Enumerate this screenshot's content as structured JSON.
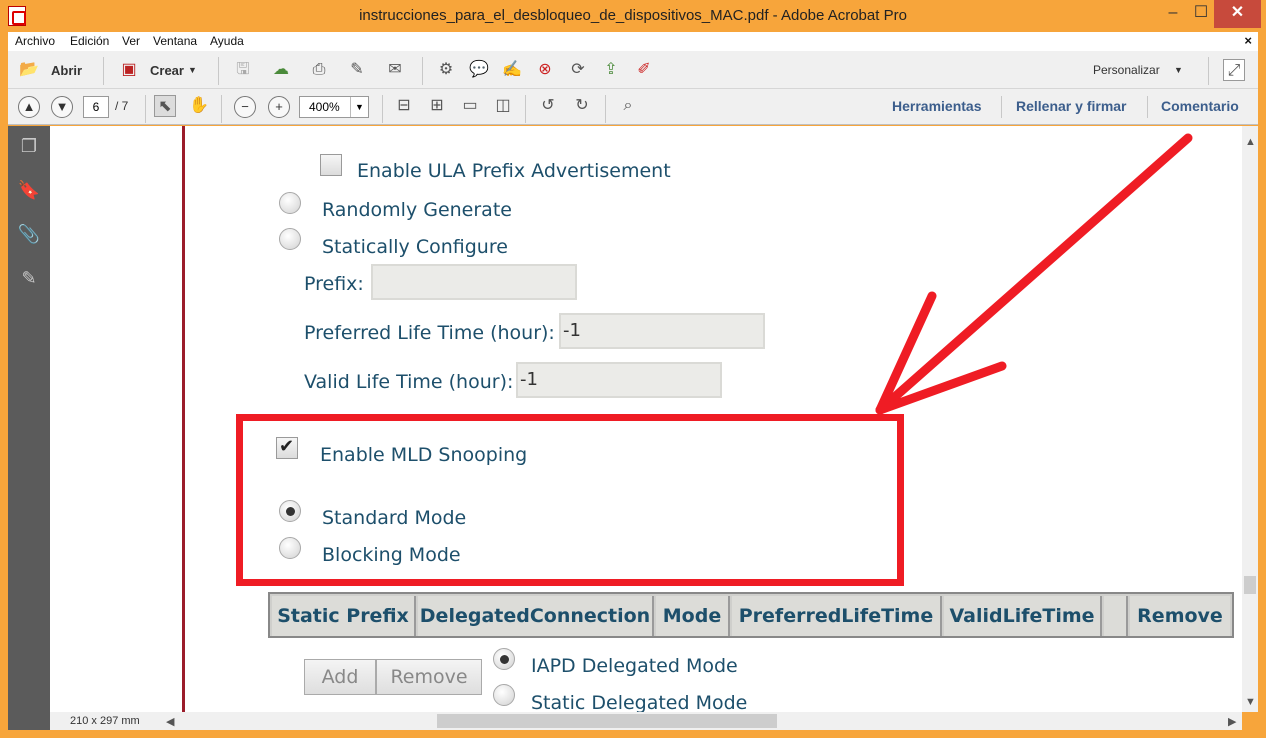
{
  "window": {
    "title": "instrucciones_para_el_desbloqueo_de_dispositivos_MAC.pdf - Adobe Acrobat Pro",
    "minimize": "‒",
    "maximize": "☐",
    "close": "✕"
  },
  "menu": [
    "Archivo",
    "Edición",
    "Ver",
    "Ventana",
    "Ayuda"
  ],
  "menu_close": "×",
  "toolbar1": {
    "open_label": "Abrir",
    "create_label": "Crear",
    "customize_label": "Personalizar"
  },
  "toolbar2": {
    "page_current": "6",
    "page_total": "/ 7",
    "zoom": "400%",
    "links": [
      "Herramientas",
      "Rellenar y firmar",
      "Comentario"
    ]
  },
  "doc": {
    "ula_label": "Enable ULA Prefix Advertisement",
    "random_label": "Randomly Generate",
    "static_label": "Statically Configure",
    "prefix_label": "Prefix:",
    "prefix_value": "",
    "preferred_label": "Preferred Life Time (hour):",
    "preferred_value": "-1",
    "valid_label": "Valid Life Time (hour):",
    "valid_value": "-1",
    "mld_label": "Enable MLD Snooping",
    "standard_label": "Standard Mode",
    "blocking_label": "Blocking Mode",
    "table_headers": [
      "Static Prefix",
      "DelegatedConnection",
      "Mode",
      "PreferredLifeTime",
      "ValidLifeTime",
      "",
      "Remove"
    ],
    "add_label": "Add",
    "remove_label": "Remove",
    "iapd_label": "IAPD Delegated Mode",
    "static_delegated_label": "Static Delegated Mode"
  },
  "status": {
    "page_size": "210 x 297 mm"
  },
  "colors": {
    "frame": "#f7a53b",
    "highlight_red": "#ef1c24",
    "doc_text": "#1d4f6b"
  }
}
